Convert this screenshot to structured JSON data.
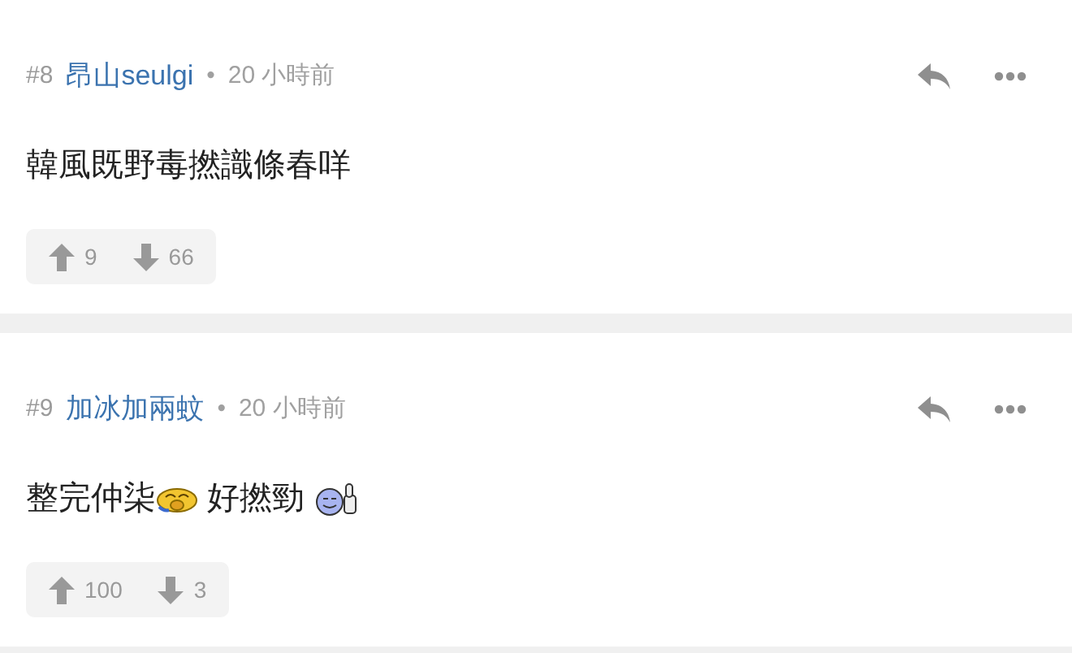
{
  "comments": [
    {
      "number": "#8",
      "author": "昂山seulgi",
      "separator": "•",
      "time": "20 小時前",
      "body": [
        {
          "kind": "text",
          "text": "韓風既野毒撚識條春咩"
        }
      ],
      "upvotes": "9",
      "downvotes": "66"
    },
    {
      "number": "#9",
      "author": "加冰加兩蚊",
      "separator": "•",
      "time": "20 小時前",
      "body": [
        {
          "kind": "text",
          "text": "整完仲柒"
        },
        {
          "kind": "frown"
        },
        {
          "kind": "text",
          "text": " 好撚勁 "
        },
        {
          "kind": "thumbsup"
        }
      ],
      "upvotes": "100",
      "downvotes": "3"
    }
  ]
}
